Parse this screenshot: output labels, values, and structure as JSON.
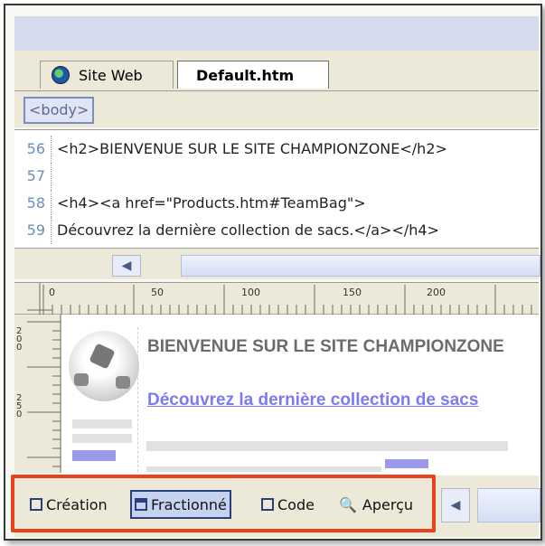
{
  "tabs": [
    {
      "label": "Site Web",
      "icon": "globe-icon"
    },
    {
      "label": "Default.htm",
      "active": true
    }
  ],
  "tag_selector": {
    "label": "<body>"
  },
  "code_lines": [
    {
      "num": "56",
      "text": "<h2>BIENVENUE SUR LE SITE CHAMPIONZONE</h2>"
    },
    {
      "num": "57",
      "text": ""
    },
    {
      "num": "58",
      "text": "<h4><a href=\"Products.htm#TeamBag\">"
    },
    {
      "num": "59",
      "text": "Découvrez la dernière collection de sacs.</a></h4>"
    }
  ],
  "ruler": {
    "top_labels": [
      "0",
      "50",
      "100",
      "150",
      "200"
    ],
    "left_labels": [
      "200",
      "250"
    ]
  },
  "design": {
    "heading": "BIENVENUE SUR LE SITE CHAMPIONZONE",
    "link": "Découvrez la dernière collection de sacs"
  },
  "view_buttons": [
    {
      "label": "Création",
      "icon": "design-view-icon"
    },
    {
      "label": "Fractionné",
      "icon": "split-view-icon",
      "selected": true
    },
    {
      "label": "Code",
      "icon": "code-view-icon"
    },
    {
      "label": "Aperçu",
      "icon": "preview-magnifier-icon"
    }
  ],
  "colors": {
    "highlight": "#e8411c",
    "line_numbers": "#6a8fb8",
    "link": "#7b7bef"
  }
}
